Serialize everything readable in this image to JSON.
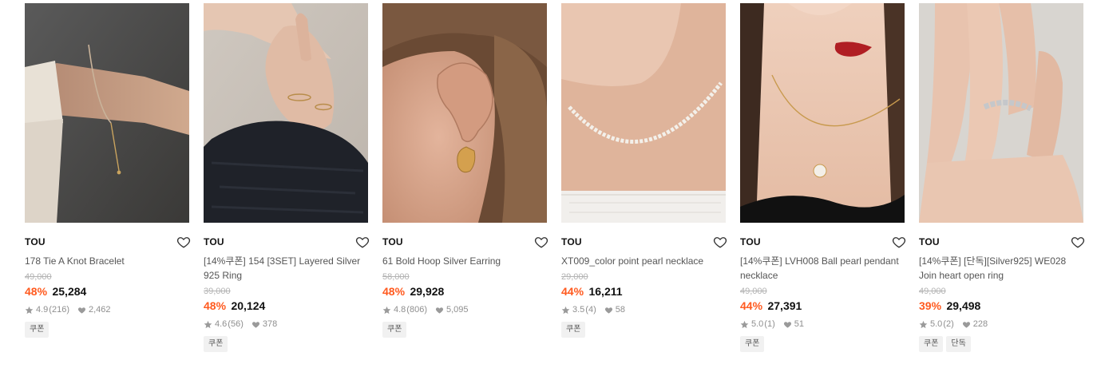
{
  "colors": {
    "discount": "#ff5a1f",
    "text": "#111111",
    "muted": "#8f8f8f",
    "strike": "#b3b3b3",
    "badge_bg": "#f1f1f1"
  },
  "products": [
    {
      "brand": "TOU",
      "name": "178 Tie A Knot Bracelet",
      "original_price": "49,000",
      "discount": "48%",
      "price": "25,284",
      "rating": "4.9",
      "reviews": "(216)",
      "likes": "2,462",
      "badges": [
        "쿠폰"
      ],
      "image_icon": "bracelet-photo"
    },
    {
      "brand": "TOU",
      "name": "[14%쿠폰] 154 [3SET] Layered Silver 925 Ring",
      "original_price": "39,000",
      "discount": "48%",
      "price": "20,124",
      "rating": "4.6",
      "reviews": "(56)",
      "likes": "378",
      "badges": [
        "쿠폰"
      ],
      "image_icon": "ring-photo"
    },
    {
      "brand": "TOU",
      "name": "61 Bold Hoop Silver Earring",
      "original_price": "58,000",
      "discount": "48%",
      "price": "29,928",
      "rating": "4.8",
      "reviews": "(806)",
      "likes": "5,095",
      "badges": [
        "쿠폰"
      ],
      "image_icon": "earring-photo"
    },
    {
      "brand": "TOU",
      "name": "XT009_color point pearl necklace",
      "original_price": "29,000",
      "discount": "44%",
      "price": "16,211",
      "rating": "3.5",
      "reviews": "(4)",
      "likes": "58",
      "badges": [
        "쿠폰"
      ],
      "image_icon": "pearl-necklace-photo"
    },
    {
      "brand": "TOU",
      "name": "[14%쿠폰] LVH008 Ball pearl pendant necklace",
      "original_price": "49,000",
      "discount": "44%",
      "price": "27,391",
      "rating": "5.0",
      "reviews": "(1)",
      "likes": "51",
      "badges": [
        "쿠폰"
      ],
      "image_icon": "pendant-necklace-photo"
    },
    {
      "brand": "TOU",
      "name": "[14%쿠폰] [단독][Silver925] WE028 Join heart open ring",
      "original_price": "49,000",
      "discount": "39%",
      "price": "29,498",
      "rating": "5.0",
      "reviews": "(2)",
      "likes": "228",
      "badges": [
        "쿠폰",
        "단독"
      ],
      "image_icon": "heart-ring-photo"
    }
  ]
}
